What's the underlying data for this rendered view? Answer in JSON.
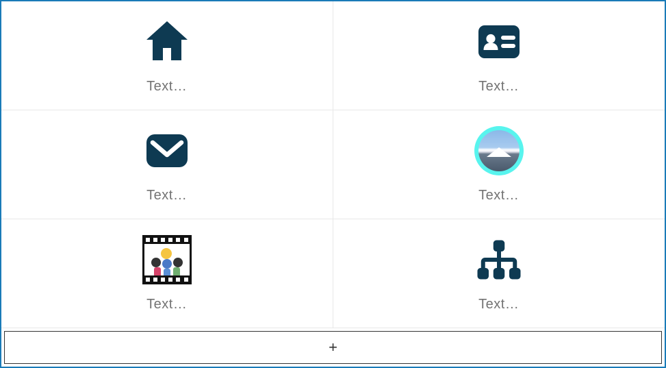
{
  "items": [
    {
      "label": "Text…",
      "icon": "home"
    },
    {
      "label": "Text…",
      "icon": "id-card"
    },
    {
      "label": "Text…",
      "icon": "mail"
    },
    {
      "label": "Text…",
      "icon": "avatar"
    },
    {
      "label": "Text…",
      "icon": "film"
    },
    {
      "label": "Text…",
      "icon": "org-tree"
    }
  ],
  "addButton": {
    "label": "+"
  },
  "colors": {
    "iconFill": "#0e3a52",
    "avatarRing": "#58f4ee"
  }
}
